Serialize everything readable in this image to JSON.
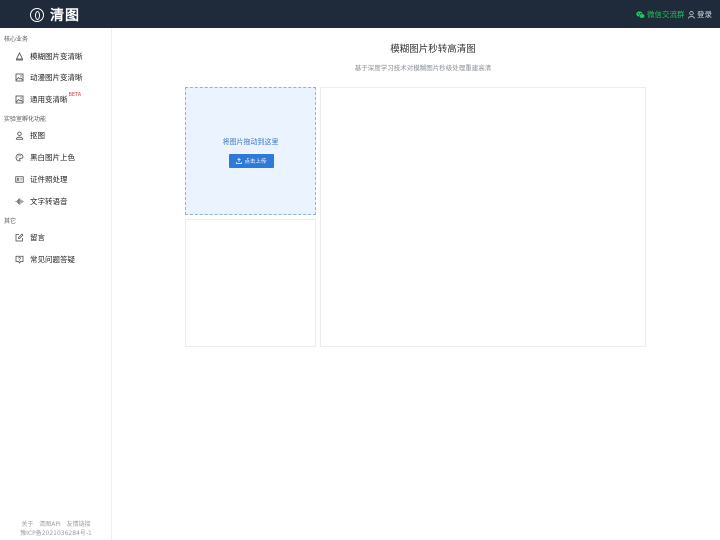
{
  "header": {
    "logo_text": "清图",
    "wechat_label": "微信交流群",
    "login_label": "登录"
  },
  "sidebar": {
    "sections": [
      {
        "title": "核心业务",
        "items": [
          {
            "label": "模糊图片变清晰",
            "icon": "image-enhance-icon"
          },
          {
            "label": "动漫图片变清晰",
            "icon": "anime-image-icon"
          },
          {
            "label": "通用变清晰",
            "icon": "general-image-icon",
            "badge": "BETA"
          }
        ]
      },
      {
        "title": "实验室孵化功能",
        "items": [
          {
            "label": "抠图",
            "icon": "person-cutout-icon"
          },
          {
            "label": "黑白图片上色",
            "icon": "palette-icon"
          },
          {
            "label": "证件照处理",
            "icon": "id-card-icon"
          },
          {
            "label": "文字转语音",
            "icon": "sound-wave-icon"
          }
        ]
      },
      {
        "title": "其它",
        "items": [
          {
            "label": "留言",
            "icon": "edit-message-icon"
          },
          {
            "label": "常见问题答疑",
            "icon": "faq-icon"
          }
        ]
      }
    ],
    "footer": {
      "links": [
        "关于",
        "清图API",
        "友情链接"
      ],
      "icp": "豫ICP备2021036284号-1"
    }
  },
  "main": {
    "title": "模糊图片秒转高清图",
    "subtitle": "基于深度学习技术对模糊图片秒级处理重建高清",
    "dropzone_text": "将图片拖动到这里",
    "upload_label": "点击上传"
  },
  "colors": {
    "header_bg": "#1f2a3a",
    "wechat_green": "#27c05c",
    "accent_blue": "#2f7ad8",
    "beta_red": "#e0453a"
  }
}
